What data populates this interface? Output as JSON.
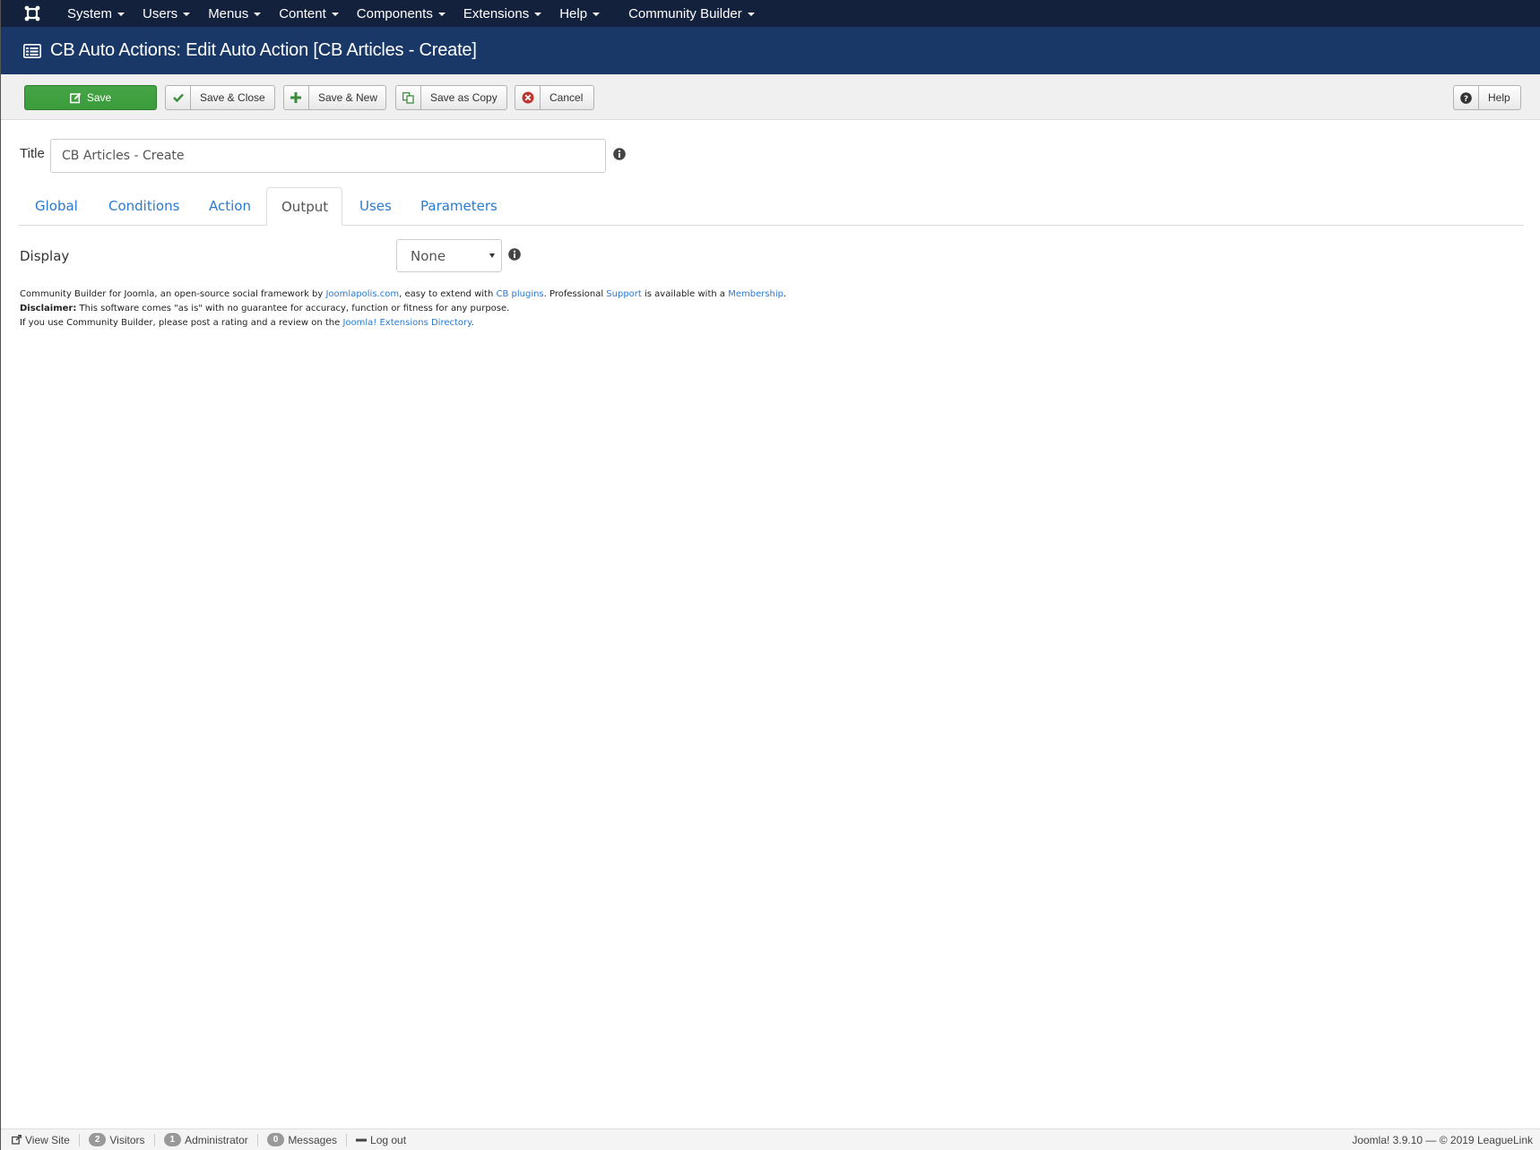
{
  "navbar": {
    "items": [
      {
        "label": "System"
      },
      {
        "label": "Users"
      },
      {
        "label": "Menus"
      },
      {
        "label": "Content"
      },
      {
        "label": "Components"
      },
      {
        "label": "Extensions"
      },
      {
        "label": "Help"
      }
    ],
    "community_builder": "Community Builder",
    "logo_icon": "joomla-logo-icon"
  },
  "header": {
    "title": "CB Auto Actions: Edit Auto Action [CB Articles - Create]",
    "icon": "list-icon"
  },
  "toolbar": {
    "save": "Save",
    "save_close": "Save & Close",
    "save_new": "Save & New",
    "save_copy": "Save as Copy",
    "cancel": "Cancel",
    "help": "Help",
    "save_color": "#46a546"
  },
  "form": {
    "title_label": "Title",
    "title_value": "CB Articles - Create",
    "tabs": [
      {
        "label": "Global"
      },
      {
        "label": "Conditions"
      },
      {
        "label": "Action"
      },
      {
        "label": "Output",
        "active": true
      },
      {
        "label": "Uses"
      },
      {
        "label": "Parameters"
      }
    ],
    "display_label": "Display",
    "display_value": "None"
  },
  "credits": {
    "line1_a": "Community Builder for Joomla, an open-source social framework by ",
    "link_joomlapolis": "Joomlapolis.com",
    "line1_b": ", easy to extend with ",
    "link_cb_plugins": "CB plugins",
    "line1_c": ". Professional ",
    "link_support": "Support",
    "line1_d": " is available with a ",
    "link_membership": "Membership",
    "line1_e": ".",
    "disclaimer_label": "Disclaimer:",
    "disclaimer_text": " This software comes \"as is\" with no guarantee for accuracy, function or fitness for any purpose.",
    "line3_a": "If you use Community Builder, please post a rating and a review on the ",
    "link_jed": "Joomla! Extensions Directory",
    "line3_b": "."
  },
  "statusbar": {
    "view_site": "View Site",
    "visitors_count": "2",
    "visitors": "Visitors",
    "admin_count": "1",
    "administrator": "Administrator",
    "messages_count": "0",
    "messages": "Messages",
    "logout": "Log out",
    "version": "Joomla! 3.9.10",
    "separator": "—",
    "copyright": "© 2019 LeagueLink"
  }
}
